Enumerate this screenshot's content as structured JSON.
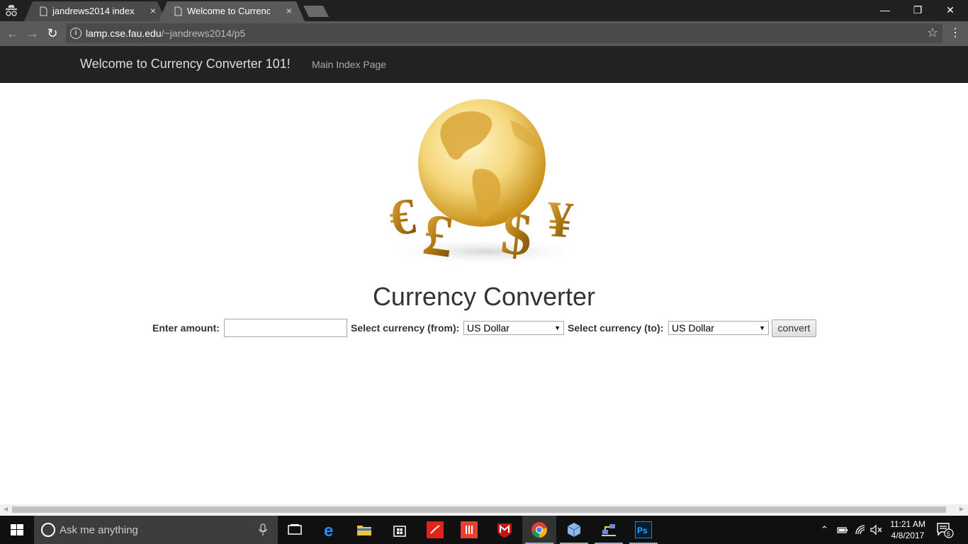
{
  "browser": {
    "tabs": [
      {
        "title": "jandrews2014 index",
        "close": "×"
      },
      {
        "title": "Welcome to Currency Co",
        "close": "×"
      }
    ],
    "window_controls": {
      "minimize": "—",
      "restore": "❐",
      "close": "✕"
    },
    "url_host": "lamp.cse.fau.edu",
    "url_path": "/~jandrews2014/p5"
  },
  "navbar": {
    "brand": "Welcome to Currency Converter 101!",
    "links": [
      "Main Index Page"
    ]
  },
  "main": {
    "title": "Currency Converter",
    "amount_label": "Enter amount:",
    "amount_value": "",
    "from_label": "Select currency (from):",
    "from_value": "US Dollar",
    "to_label": "Select currency (to):",
    "to_value": "US Dollar",
    "convert_label": "convert"
  },
  "taskbar": {
    "search_placeholder": "Ask me anything",
    "time": "11:21 AM",
    "date": "4/8/2017",
    "notification_count": "5",
    "apps": [
      "task-view-icon",
      "edge-icon",
      "file-explorer-icon",
      "store-icon",
      "acrobat-icon",
      "office-icon",
      "mcafee-icon",
      "chrome-icon",
      "virtualbox-icon",
      "network-app-icon",
      "photoshop-icon"
    ]
  },
  "colors": {
    "navbar_bg": "#222222",
    "brand_text": "#dddddd",
    "nav_link_text": "#aaaaaa",
    "title_text": "#333333",
    "gold": "#c8901a"
  }
}
